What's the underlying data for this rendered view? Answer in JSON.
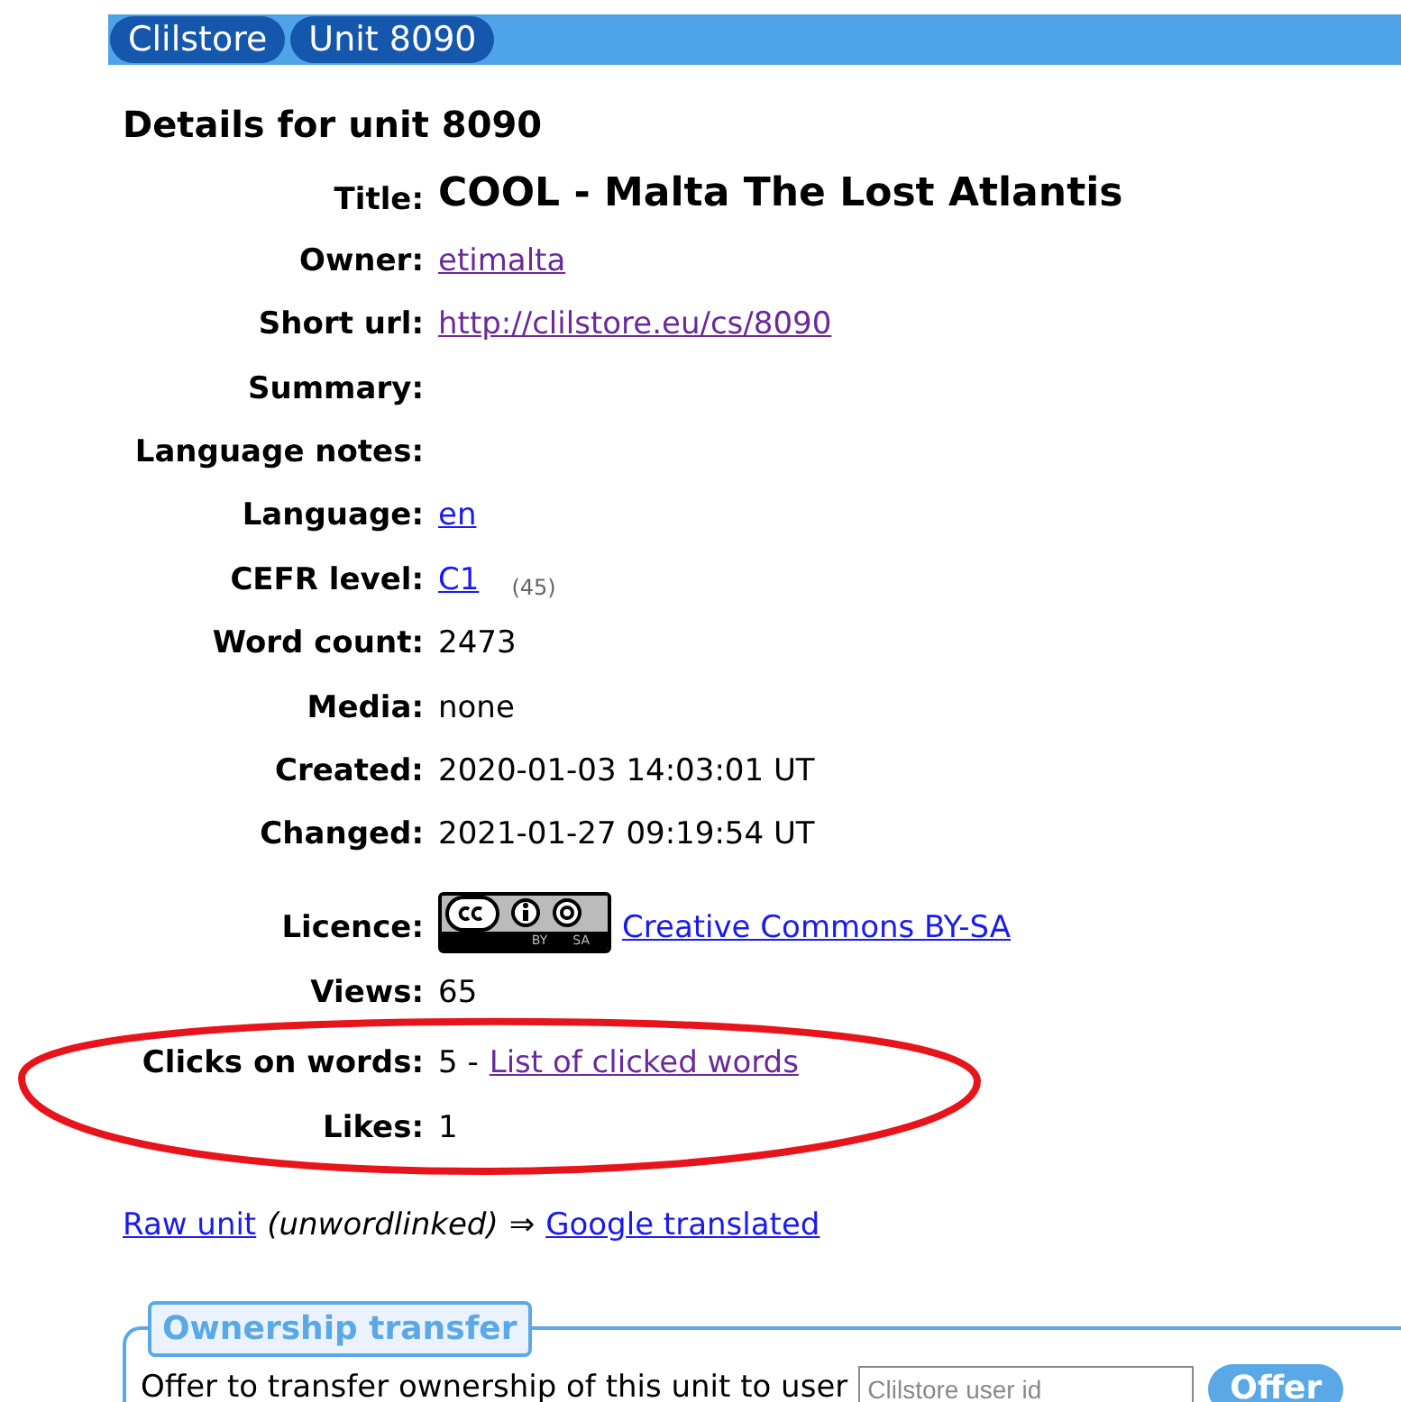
{
  "breadcrumbs": [
    {
      "label": "Clilstore"
    },
    {
      "label": "Unit 8090"
    }
  ],
  "heading": "Details for unit 8090",
  "rows": [
    {
      "label": "Title:",
      "parts": [
        {
          "kind": "title",
          "text": "COOL - Malta The Lost Atlantis"
        }
      ]
    },
    {
      "label": "Owner:",
      "parts": [
        {
          "kind": "link",
          "text": "etimalta",
          "visited": true
        }
      ]
    },
    {
      "label": "Short url:",
      "parts": [
        {
          "kind": "link",
          "text": "http://clilstore.eu/cs/8090",
          "visited": true
        }
      ]
    },
    {
      "label": "Summary:",
      "parts": []
    },
    {
      "label": "Language notes:",
      "parts": []
    },
    {
      "label": "Language:",
      "parts": [
        {
          "kind": "link",
          "text": "en",
          "visited": false
        }
      ]
    },
    {
      "label": "CEFR level:",
      "parts": [
        {
          "kind": "link",
          "text": "C1",
          "visited": false
        },
        {
          "kind": "count",
          "text": "(45)"
        }
      ]
    },
    {
      "label": "Word count:",
      "parts": [
        {
          "kind": "text",
          "text": "2473"
        }
      ]
    },
    {
      "label": "Media:",
      "parts": [
        {
          "kind": "text",
          "text": "none"
        }
      ]
    },
    {
      "label": "Created:",
      "parts": [
        {
          "kind": "text",
          "text": "2020-01-03 14:03:01 UT"
        }
      ]
    },
    {
      "label": "Changed:",
      "parts": [
        {
          "kind": "text",
          "text": "2021-01-27 09:19:54 UT"
        }
      ]
    },
    {
      "label": "Licence:",
      "parts": [
        {
          "kind": "badge",
          "labels": [
            "BY",
            "SA"
          ]
        },
        {
          "kind": "link",
          "text": "Creative Commons BY-SA",
          "visited": false
        }
      ]
    },
    {
      "label": "Views:",
      "parts": [
        {
          "kind": "text",
          "text": "65"
        }
      ]
    },
    {
      "label": "Clicks on words:",
      "parts": [
        {
          "kind": "text",
          "text": "5 -"
        },
        {
          "kind": "link",
          "text": "List of clicked words",
          "visited": true
        }
      ]
    },
    {
      "label": "Likes:",
      "parts": [
        {
          "kind": "text",
          "text": "1"
        }
      ]
    }
  ],
  "links_line": [
    {
      "kind": "link",
      "text": "Raw unit",
      "visited": false
    },
    {
      "kind": "italic",
      "text": "(unwordlinked)"
    },
    {
      "kind": "text",
      "text": "⇒"
    },
    {
      "kind": "link",
      "text": "Google translated",
      "visited": false
    }
  ],
  "ownership_transfer": {
    "legend": "Ownership transfer",
    "prompt": "Offer to transfer ownership of this unit to user",
    "placeholder": "Clilstore user id",
    "button": "Offer"
  }
}
